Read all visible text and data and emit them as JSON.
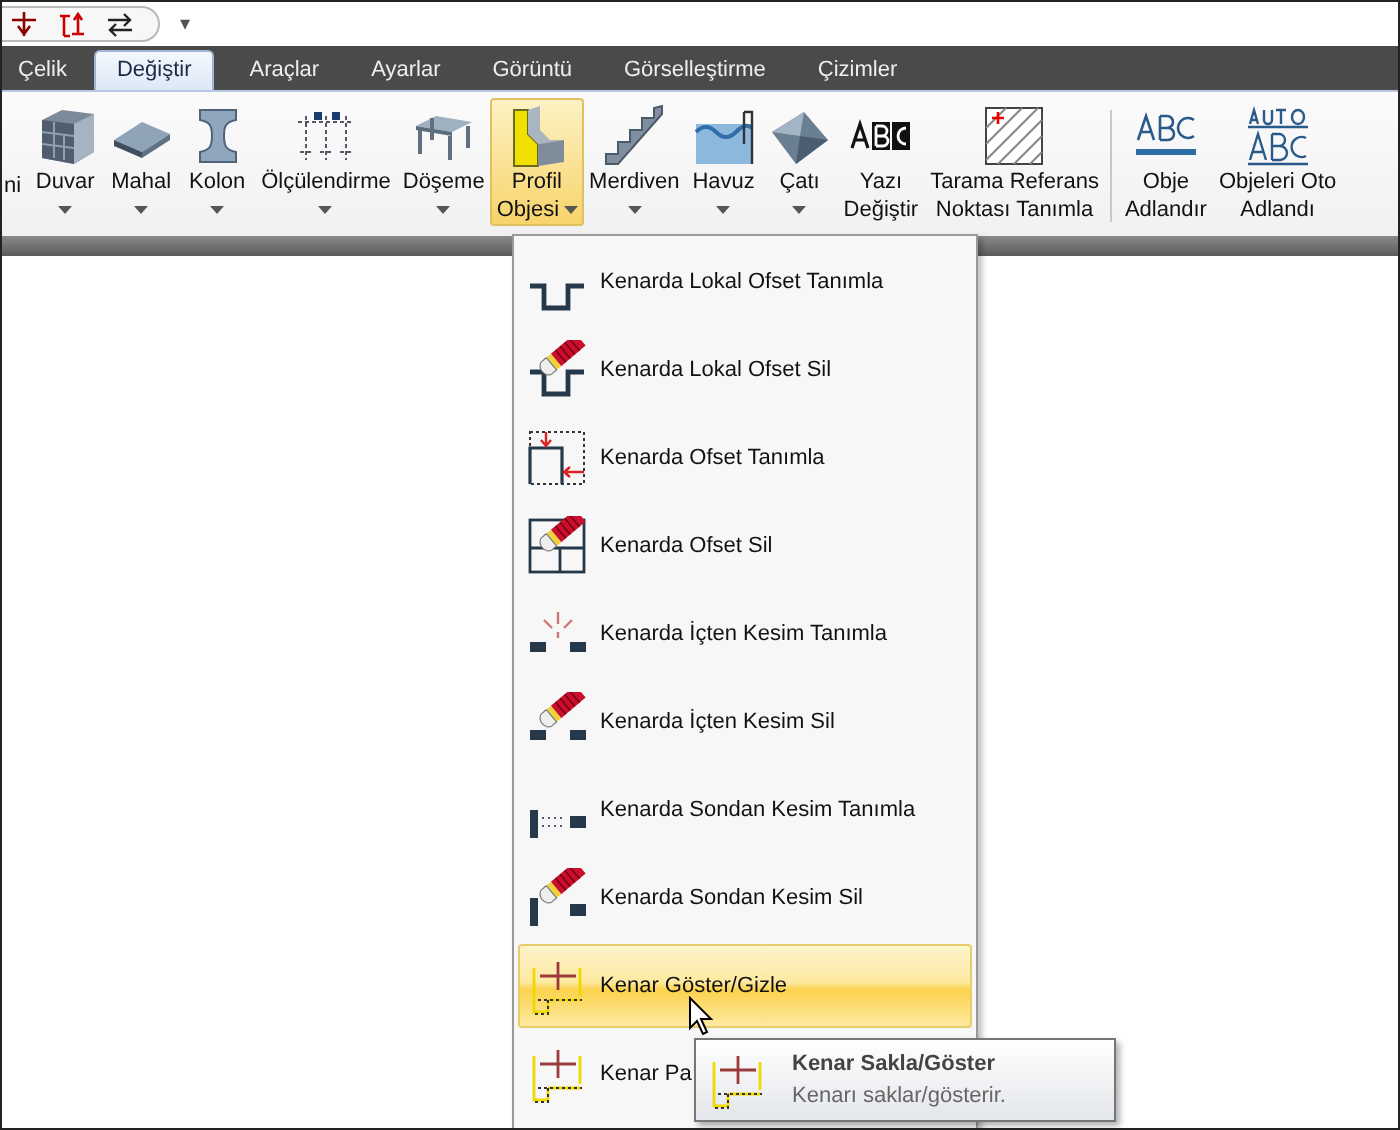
{
  "quick_access": {
    "dropdown": "▾"
  },
  "tabs": [
    {
      "label": "Çelik",
      "selected": false
    },
    {
      "label": "Değiştir",
      "selected": true
    },
    {
      "label": "Araçlar",
      "selected": false
    },
    {
      "label": "Ayarlar",
      "selected": false
    },
    {
      "label": "Görüntü",
      "selected": false
    },
    {
      "label": "Görselleştirme",
      "selected": false
    },
    {
      "label": "Çizimler",
      "selected": false
    }
  ],
  "ribbon": [
    {
      "kind": "none",
      "lines": [
        "ni"
      ],
      "dropdown": false,
      "selected": false
    },
    {
      "kind": "wall",
      "lines": [
        "Duvar"
      ],
      "dropdown": true,
      "selected": false
    },
    {
      "kind": "room",
      "lines": [
        "Mahal"
      ],
      "dropdown": true,
      "selected": false
    },
    {
      "kind": "column",
      "lines": [
        "Kolon"
      ],
      "dropdown": true,
      "selected": false
    },
    {
      "kind": "dimension",
      "lines": [
        "Ölçülendirme"
      ],
      "dropdown": true,
      "selected": false
    },
    {
      "kind": "slab",
      "lines": [
        "Döşeme"
      ],
      "dropdown": true,
      "selected": false
    },
    {
      "kind": "profile",
      "lines": [
        "Profil",
        "Objesi"
      ],
      "dropdown": true,
      "selected": true
    },
    {
      "kind": "stair",
      "lines": [
        "Merdiven"
      ],
      "dropdown": true,
      "selected": false
    },
    {
      "kind": "pool",
      "lines": [
        "Havuz"
      ],
      "dropdown": true,
      "selected": false
    },
    {
      "kind": "roof",
      "lines": [
        "Çatı"
      ],
      "dropdown": true,
      "selected": false
    },
    {
      "kind": "text",
      "lines": [
        "Yazı",
        "Değiştir"
      ],
      "dropdown": false,
      "selected": false
    },
    {
      "kind": "hatch",
      "lines": [
        "Tarama Referans",
        "Noktası Tanımla"
      ],
      "dropdown": false,
      "selected": false
    },
    {
      "kind": "separator"
    },
    {
      "kind": "label",
      "lines": [
        "Obje",
        "Adlandır"
      ],
      "dropdown": false,
      "selected": false
    },
    {
      "kind": "autolabel",
      "lines": [
        "Objeleri Oto",
        "Adlandı"
      ],
      "dropdown": false,
      "selected": false
    }
  ],
  "menu": [
    {
      "kind": "offset-local",
      "label": "Kenarda Lokal Ofset Tanımla",
      "selected": false
    },
    {
      "kind": "offset-local-erase",
      "label": "Kenarda Lokal Ofset Sil",
      "selected": false
    },
    {
      "kind": "offset",
      "label": "Kenarda Ofset Tanımla",
      "selected": false
    },
    {
      "kind": "offset-erase",
      "label": "Kenarda Ofset Sil",
      "selected": false
    },
    {
      "kind": "cut-inner",
      "label": "Kenarda İçten Kesim Tanımla",
      "selected": false
    },
    {
      "kind": "cut-inner-erase",
      "label": "Kenarda İçten Kesim Sil",
      "selected": false
    },
    {
      "kind": "cut-end",
      "label": "Kenarda Sondan Kesim Tanımla",
      "selected": false
    },
    {
      "kind": "cut-end-erase",
      "label": "Kenarda Sondan Kesim Sil",
      "selected": false
    },
    {
      "kind": "edge",
      "label": "Kenar Göster/Gizle",
      "selected": true
    },
    {
      "kind": "edge",
      "label": "Kenar Pa",
      "selected": false
    }
  ],
  "tooltip": {
    "kind": "edge",
    "title": "Kenar Sakla/Göster",
    "description": "Kenarı saklar/gösterir."
  }
}
